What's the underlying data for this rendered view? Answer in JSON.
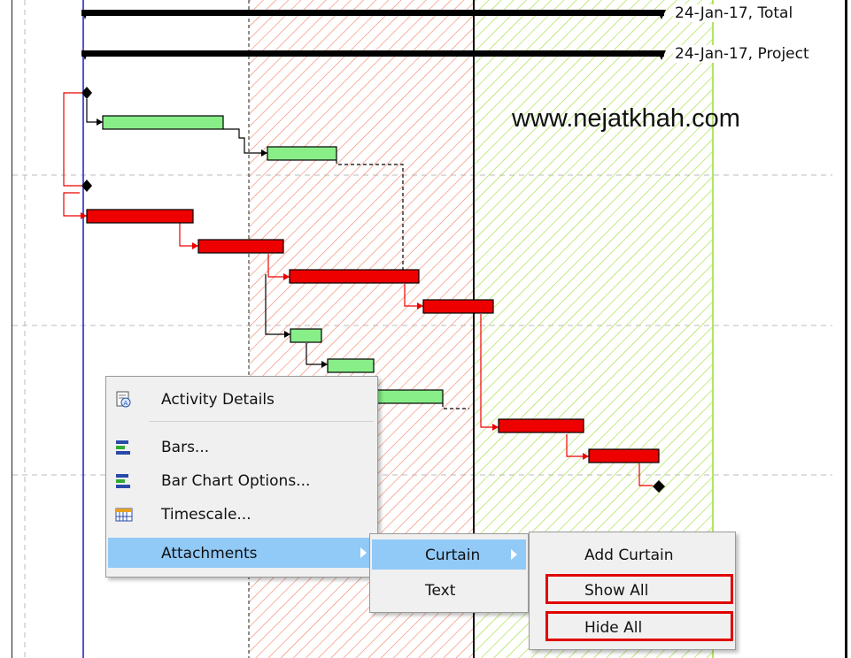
{
  "gantt": {
    "summary_labels": [
      "24-Jan-17, Total",
      "24-Jan-17, Project"
    ],
    "watermark": "www.nejatkhah.com"
  },
  "context_menu": {
    "items": [
      {
        "label": "Activity Details",
        "icon": "activity-details-icon"
      },
      {
        "label": "Bars...",
        "icon": "bars-icon"
      },
      {
        "label": "Bar Chart Options...",
        "icon": "bar-chart-options-icon"
      },
      {
        "label": "Timescale...",
        "icon": "timescale-icon"
      },
      {
        "label": "Attachments",
        "submenu": true,
        "highlighted": true
      }
    ]
  },
  "attachments_submenu": {
    "items": [
      {
        "label": "Curtain",
        "submenu": true,
        "highlighted": true
      },
      {
        "label": "Text"
      }
    ]
  },
  "curtain_submenu": {
    "items": [
      {
        "label": "Add Curtain"
      },
      {
        "label": "Show All",
        "emphasized": true
      },
      {
        "label": "Hide All",
        "emphasized": true
      }
    ]
  },
  "colors": {
    "highlight": "#91c9f7",
    "emphasis_box": "#e00000",
    "critical_bar": "#ee0000",
    "normal_bar": "#88ee88",
    "curtain_orange": "#f08060",
    "curtain_green": "#99dd33",
    "data_date_line": "#1a1acc"
  }
}
